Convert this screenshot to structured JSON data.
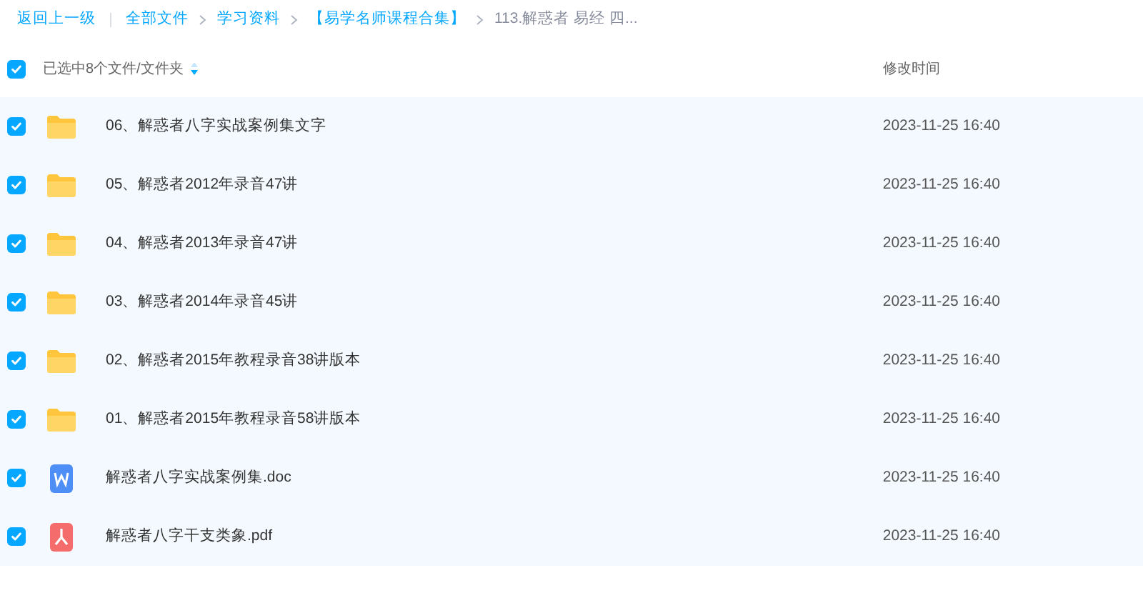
{
  "breadcrumb": {
    "back": "返回上一级",
    "items": [
      {
        "label": "全部文件",
        "current": false
      },
      {
        "label": "学习资料",
        "current": false
      },
      {
        "label": "【易学名师课程合集】",
        "current": false
      },
      {
        "label": "113.解惑者 易经 四...",
        "current": true
      }
    ]
  },
  "header": {
    "checked": true,
    "selection": "已选中8个文件/文件夹",
    "column_time": "修改时间"
  },
  "rows": [
    {
      "kind": "folder",
      "name": "06、解惑者八字实战案例集文字",
      "time": "2023-11-25 16:40",
      "checked": true
    },
    {
      "kind": "folder",
      "name": "05、解惑者2012年录音47讲",
      "time": "2023-11-25 16:40",
      "checked": true
    },
    {
      "kind": "folder",
      "name": "04、解惑者2013年录音47讲",
      "time": "2023-11-25 16:40",
      "checked": true
    },
    {
      "kind": "folder",
      "name": "03、解惑者2014年录音45讲",
      "time": "2023-11-25 16:40",
      "checked": true
    },
    {
      "kind": "folder",
      "name": "02、解惑者2015年教程录音38讲版本",
      "time": "2023-11-25 16:40",
      "checked": true
    },
    {
      "kind": "folder",
      "name": "01、解惑者2015年教程录音58讲版本",
      "time": "2023-11-25 16:40",
      "checked": true
    },
    {
      "kind": "doc",
      "name": "解惑者八字实战案例集.doc",
      "time": "2023-11-25 16:40",
      "checked": true
    },
    {
      "kind": "pdf",
      "name": "解惑者八字干支类象.pdf",
      "time": "2023-11-25 16:40",
      "checked": true
    }
  ]
}
